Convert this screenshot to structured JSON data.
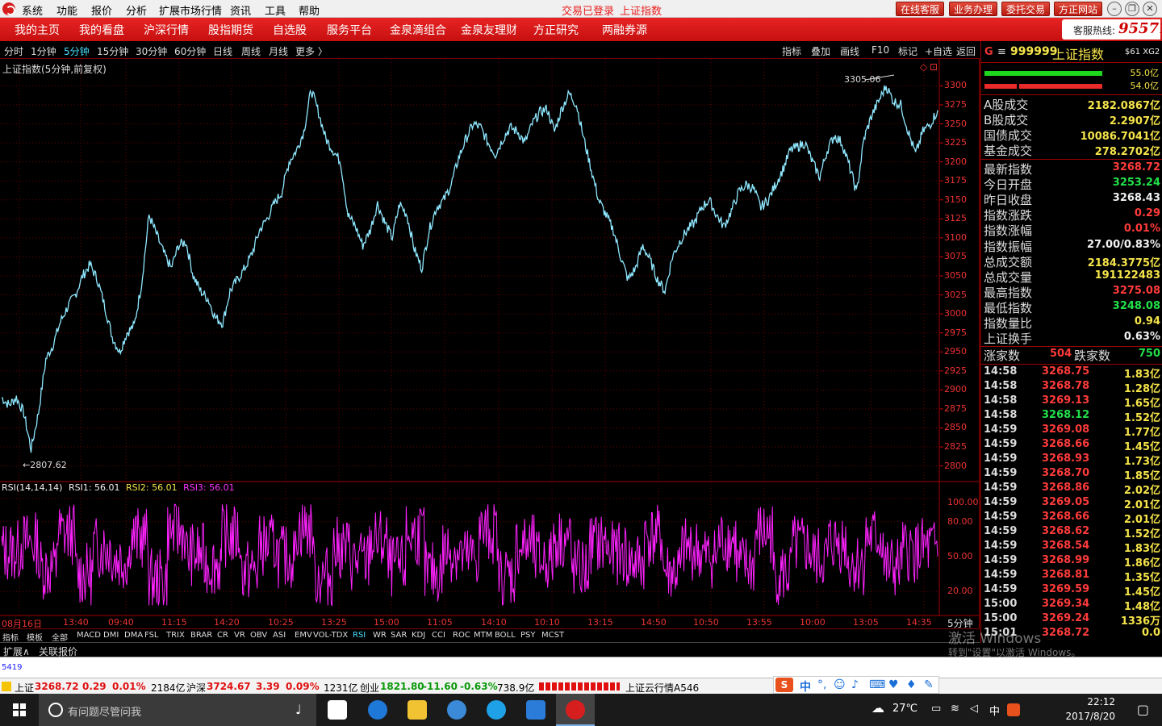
{
  "titlebar": {
    "menu": [
      "系统",
      "功能",
      "报价",
      "分析",
      "扩展市场行情",
      "资讯",
      "工具",
      "帮助"
    ],
    "login_status": "交易已登录",
    "index_name": "上证指数",
    "buttons": [
      "在线客服",
      "业务办理",
      "委托交易",
      "方正网站"
    ]
  },
  "navbar": {
    "items": [
      "我的主页",
      "我的看盘",
      "沪深行情",
      "股指期货",
      "自选股",
      "服务平台",
      "金泉滴组合",
      "金泉友理财",
      "方正研究",
      "两融券源"
    ],
    "hotline_label": "客服热线:",
    "hotline_number": "95571"
  },
  "periods": {
    "items": [
      "分时",
      "1分钟",
      "5分钟",
      "15分钟",
      "30分钟",
      "60分钟",
      "日线",
      "周线",
      "月线",
      "更多 〉"
    ],
    "active_index": 2
  },
  "chart_tools": [
    "指标",
    "叠加",
    "画线",
    "F10",
    "标记",
    "+自选",
    "返回"
  ],
  "chart": {
    "caption": "上证指数(5分钟,前复权)",
    "high_label": "3305.06",
    "low_label": "2807.62",
    "rsi_header": {
      "name": "RSI(14,14,14)",
      "rsi1": "RSI1: 56.01",
      "rsi2": "RSI2: 56.01",
      "rsi3": "RSI3: 56.01"
    },
    "period_label": "5分钟"
  },
  "chart_data": {
    "type": "line",
    "title": "上证指数(5分钟,前复权)",
    "price_axis_ticks": [
      3300,
      3275,
      3250,
      3225,
      3200,
      3175,
      3150,
      3125,
      3100,
      3075,
      3050,
      3025,
      3000,
      2975,
      2950,
      2925,
      2900,
      2875,
      2850,
      2825,
      2800
    ],
    "ylim": [
      2790,
      3310
    ],
    "rsi_axis_ticks": [
      "100.00",
      "80.00",
      "50.00",
      "20.00"
    ],
    "x_tick_labels": [
      "08月16日",
      "13:40",
      "09:40",
      "11:15",
      "14:20",
      "10:25",
      "13:25",
      "15:00",
      "11:05",
      "14:10",
      "10:10",
      "13:15",
      "14:50",
      "10:50",
      "13:55",
      "10:00",
      "13:05",
      "14:35"
    ],
    "series": [
      {
        "name": "上证指数",
        "color": "#8fe8ff",
        "values": [
          2890,
          2880,
          2890,
          2870,
          2822,
          2870,
          2940,
          2960,
          2990,
          3010,
          3025,
          3050,
          3065,
          3045,
          3010,
          2970,
          2950,
          2975,
          2985,
          3040,
          3130,
          3105,
          3080,
          3060,
          3090,
          3095,
          3050,
          3030,
          3020,
          2995,
          2988,
          3030,
          3045,
          3060,
          3080,
          3110,
          3125,
          3145,
          3160,
          3200,
          3215,
          3240,
          3295,
          3265,
          3230,
          3215,
          3200,
          3130,
          3115,
          3090,
          3110,
          3145,
          3120,
          3100,
          3145,
          3130,
          3085,
          3060,
          3110,
          3140,
          3150,
          3170,
          3205,
          3230,
          3250,
          3245,
          3225,
          3210,
          3230,
          3245,
          3240,
          3225,
          3250,
          3265,
          3270,
          3240,
          3270,
          3290,
          3275,
          3230,
          3190,
          3150,
          3130,
          3110,
          3075,
          3045,
          3060,
          3090,
          3070,
          3045,
          3030,
          3075,
          3095,
          3110,
          3120,
          3140,
          3150,
          3130,
          3115,
          3135,
          3160,
          3170,
          3165,
          3140,
          3150,
          3170,
          3190,
          3215,
          3220,
          3225,
          3200,
          3180,
          3215,
          3235,
          3225,
          3195,
          3160,
          3230,
          3260,
          3280,
          3300,
          3280,
          3275,
          3240,
          3210,
          3240,
          3250,
          3268
        ]
      },
      {
        "name": "RSI",
        "color": "#ff22ff",
        "values": [
          55,
          62,
          40,
          70,
          35,
          58,
          48,
          66,
          30,
          72,
          52,
          44,
          68,
          38,
          60,
          50,
          74,
          33,
          57,
          46,
          63,
          41,
          69,
          36,
          55,
          49,
          71,
          34,
          59,
          47,
          65,
          39,
          61,
          53,
          45,
          67,
          37,
          56,
          50,
          64,
          42,
          70,
          35,
          58,
          48,
          62,
          44,
          66,
          40,
          54,
          56
        ]
      }
    ]
  },
  "right_panel": {
    "code": "999999",
    "name": "上证指数",
    "tag": "$61 XG2",
    "bar_up_value": "55.0亿",
    "bar_down_value": "54.0亿",
    "volumes": [
      {
        "label": "A股成交",
        "value": "2182.0867亿"
      },
      {
        "label": "B股成交",
        "value": "2.2907亿"
      },
      {
        "label": "国债成交",
        "value": "10086.7041亿"
      },
      {
        "label": "基金成交",
        "value": "278.2702亿"
      }
    ],
    "stats": [
      {
        "label": "最新指数",
        "value": "3268.72",
        "color": "red"
      },
      {
        "label": "今日开盘",
        "value": "3253.24",
        "color": "green"
      },
      {
        "label": "昨日收盘",
        "value": "3268.43",
        "color": "white"
      },
      {
        "label": "指数涨跌",
        "value": "0.29",
        "color": "red"
      },
      {
        "label": "指数涨幅",
        "value": "0.01%",
        "color": "red"
      },
      {
        "label": "指数振幅",
        "value": "27.00/0.83%",
        "color": "white"
      },
      {
        "label": "总成交额",
        "value": "2184.3775亿",
        "color": "yellow"
      },
      {
        "label": "总成交量",
        "value": "191122483",
        "color": "yellow"
      },
      {
        "label": "最高指数",
        "value": "3275.08",
        "color": "red"
      },
      {
        "label": "最低指数",
        "value": "3248.08",
        "color": "green"
      },
      {
        "label": "指数量比",
        "value": "0.94",
        "color": "yellow"
      },
      {
        "label": "上证换手",
        "value": "0.63%",
        "color": "white"
      }
    ],
    "breadth": {
      "up_label": "涨家数",
      "up_value": "504",
      "down_label": "跌家数",
      "down_value": "750"
    },
    "ticks": [
      {
        "time": "14:58",
        "price": "3268.75",
        "vol": "1.83亿",
        "color": "red"
      },
      {
        "time": "14:58",
        "price": "3268.78",
        "vol": "1.28亿",
        "color": "red"
      },
      {
        "time": "14:58",
        "price": "3269.13",
        "vol": "1.65亿",
        "color": "red"
      },
      {
        "time": "14:58",
        "price": "3268.12",
        "vol": "1.52亿",
        "color": "green"
      },
      {
        "time": "14:59",
        "price": "3269.08",
        "vol": "1.77亿",
        "color": "red"
      },
      {
        "time": "14:59",
        "price": "3268.66",
        "vol": "1.45亿",
        "color": "red"
      },
      {
        "time": "14:59",
        "price": "3268.93",
        "vol": "1.73亿",
        "color": "red"
      },
      {
        "time": "14:59",
        "price": "3268.70",
        "vol": "1.85亿",
        "color": "red"
      },
      {
        "time": "14:59",
        "price": "3268.86",
        "vol": "2.02亿",
        "color": "red"
      },
      {
        "time": "14:59",
        "price": "3269.05",
        "vol": "2.01亿",
        "color": "red"
      },
      {
        "time": "14:59",
        "price": "3268.66",
        "vol": "2.01亿",
        "color": "red"
      },
      {
        "time": "14:59",
        "price": "3268.62",
        "vol": "1.52亿",
        "color": "red"
      },
      {
        "time": "14:59",
        "price": "3268.54",
        "vol": "1.83亿",
        "color": "red"
      },
      {
        "time": "14:59",
        "price": "3268.99",
        "vol": "1.86亿",
        "color": "red"
      },
      {
        "time": "14:59",
        "price": "3268.81",
        "vol": "1.35亿",
        "color": "red"
      },
      {
        "time": "14:59",
        "price": "3269.59",
        "vol": "1.45亿",
        "color": "red"
      },
      {
        "time": "15:00",
        "price": "3269.34",
        "vol": "1.48亿",
        "color": "red"
      },
      {
        "time": "15:00",
        "price": "3269.24",
        "vol": "1336万",
        "color": "red"
      },
      {
        "time": "15:01",
        "price": "3268.72",
        "vol": "0.0",
        "color": "red"
      }
    ]
  },
  "indicator_tabs": {
    "items": [
      "指标",
      "模板",
      "全部",
      "MACD",
      "DMI",
      "DMA",
      "FSL",
      "TRIX",
      "BRAR",
      "CR",
      "VR",
      "OBV",
      "ASI",
      "EMV",
      "VOL-TDX",
      "RSI",
      "WR",
      "SAR",
      "KDJ",
      "CCI",
      "ROC",
      "MTM",
      "BOLL",
      "PSY",
      "MCST"
    ],
    "active_index": 15
  },
  "ext_tabs": [
    "扩展∧",
    "关联报价"
  ],
  "command_line": "5419",
  "quote_bar": {
    "sh_name": "上证",
    "sh_price": "3268.72",
    "sh_chg": "0.29",
    "sh_pct": "0.01%",
    "sh_amt": "2184亿",
    "hs_name": "沪深",
    "hs_price": "3724.67",
    "hs_chg": "3.39",
    "hs_pct": "0.09%",
    "hs_amt": "1231亿",
    "cy_name": "创业",
    "cy_price": "1821.80",
    "cy_chg": "-11.60",
    "cy_pct": "-0.63%",
    "cy_amt": "738.9亿",
    "cloud": "上证云行情A546"
  },
  "ime": {
    "mode": "中"
  },
  "watermark": {
    "line1": "激活 Windows",
    "line2": "转到\"设置\"以激活 Windows。"
  },
  "taskbar": {
    "search_placeholder": "有问题尽管问我",
    "weather": "27℃",
    "ime_tray": "中",
    "time": "22:12",
    "date": "2017/8/20"
  }
}
